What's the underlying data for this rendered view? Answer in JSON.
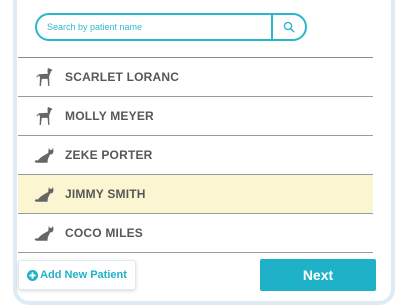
{
  "search": {
    "placeholder": "Search by patient name",
    "icon": "search-icon"
  },
  "patients": [
    {
      "name": "SCARLET LORANC",
      "icon": "dog-icon",
      "selected": false
    },
    {
      "name": "MOLLY MEYER",
      "icon": "dog-icon",
      "selected": false
    },
    {
      "name": "ZEKE PORTER",
      "icon": "cat-icon",
      "selected": false
    },
    {
      "name": "JIMMY SMITH",
      "icon": "cat-icon",
      "selected": true
    },
    {
      "name": "COCO MILES",
      "icon": "cat-icon",
      "selected": false
    }
  ],
  "actions": {
    "add_label": "Add New Patient",
    "add_icon": "plus-circle-icon",
    "next_label": "Next"
  },
  "colors": {
    "accent": "#1fb1c8",
    "selected_row": "#fbf5d2",
    "text": "#575757",
    "frame": "#dcebf4"
  }
}
